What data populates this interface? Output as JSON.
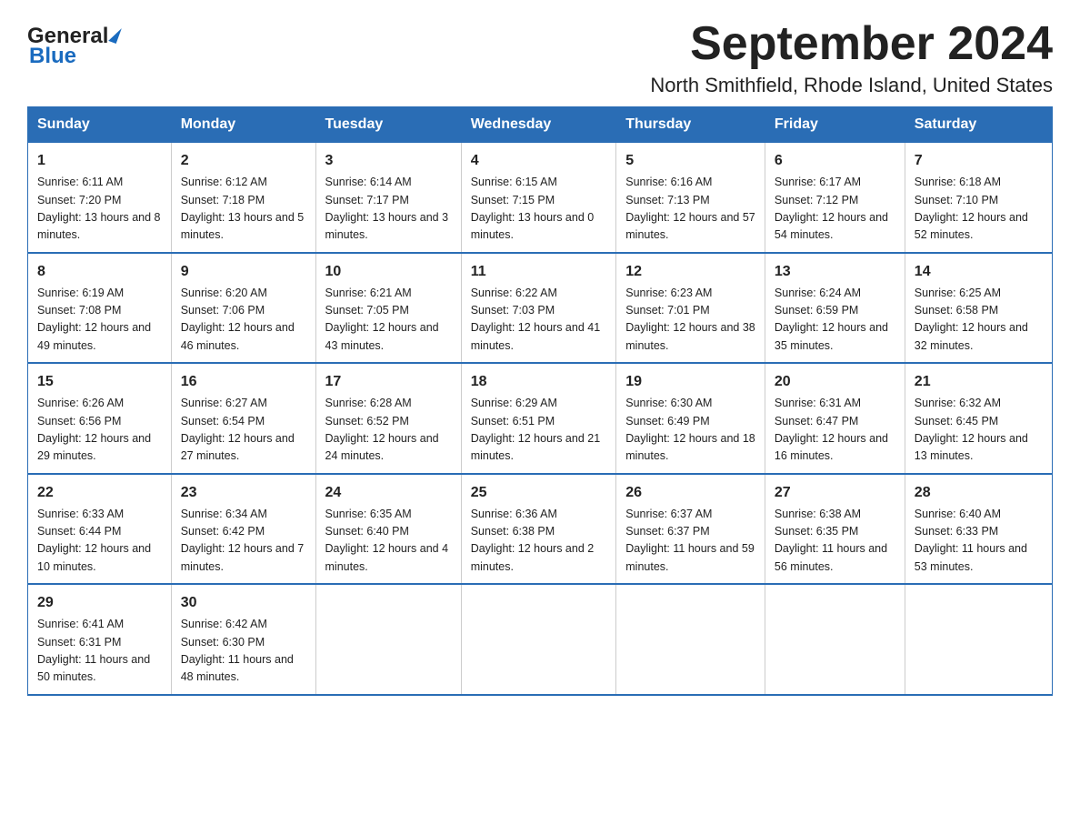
{
  "header": {
    "title": "September 2024",
    "subtitle": "North Smithfield, Rhode Island, United States",
    "logo_general": "General",
    "logo_blue": "Blue"
  },
  "calendar": {
    "days_of_week": [
      "Sunday",
      "Monday",
      "Tuesday",
      "Wednesday",
      "Thursday",
      "Friday",
      "Saturday"
    ],
    "weeks": [
      [
        {
          "date": "1",
          "sunrise": "6:11 AM",
          "sunset": "7:20 PM",
          "daylight": "13 hours and 8 minutes."
        },
        {
          "date": "2",
          "sunrise": "6:12 AM",
          "sunset": "7:18 PM",
          "daylight": "13 hours and 5 minutes."
        },
        {
          "date": "3",
          "sunrise": "6:14 AM",
          "sunset": "7:17 PM",
          "daylight": "13 hours and 3 minutes."
        },
        {
          "date": "4",
          "sunrise": "6:15 AM",
          "sunset": "7:15 PM",
          "daylight": "13 hours and 0 minutes."
        },
        {
          "date": "5",
          "sunrise": "6:16 AM",
          "sunset": "7:13 PM",
          "daylight": "12 hours and 57 minutes."
        },
        {
          "date": "6",
          "sunrise": "6:17 AM",
          "sunset": "7:12 PM",
          "daylight": "12 hours and 54 minutes."
        },
        {
          "date": "7",
          "sunrise": "6:18 AM",
          "sunset": "7:10 PM",
          "daylight": "12 hours and 52 minutes."
        }
      ],
      [
        {
          "date": "8",
          "sunrise": "6:19 AM",
          "sunset": "7:08 PM",
          "daylight": "12 hours and 49 minutes."
        },
        {
          "date": "9",
          "sunrise": "6:20 AM",
          "sunset": "7:06 PM",
          "daylight": "12 hours and 46 minutes."
        },
        {
          "date": "10",
          "sunrise": "6:21 AM",
          "sunset": "7:05 PM",
          "daylight": "12 hours and 43 minutes."
        },
        {
          "date": "11",
          "sunrise": "6:22 AM",
          "sunset": "7:03 PM",
          "daylight": "12 hours and 41 minutes."
        },
        {
          "date": "12",
          "sunrise": "6:23 AM",
          "sunset": "7:01 PM",
          "daylight": "12 hours and 38 minutes."
        },
        {
          "date": "13",
          "sunrise": "6:24 AM",
          "sunset": "6:59 PM",
          "daylight": "12 hours and 35 minutes."
        },
        {
          "date": "14",
          "sunrise": "6:25 AM",
          "sunset": "6:58 PM",
          "daylight": "12 hours and 32 minutes."
        }
      ],
      [
        {
          "date": "15",
          "sunrise": "6:26 AM",
          "sunset": "6:56 PM",
          "daylight": "12 hours and 29 minutes."
        },
        {
          "date": "16",
          "sunrise": "6:27 AM",
          "sunset": "6:54 PM",
          "daylight": "12 hours and 27 minutes."
        },
        {
          "date": "17",
          "sunrise": "6:28 AM",
          "sunset": "6:52 PM",
          "daylight": "12 hours and 24 minutes."
        },
        {
          "date": "18",
          "sunrise": "6:29 AM",
          "sunset": "6:51 PM",
          "daylight": "12 hours and 21 minutes."
        },
        {
          "date": "19",
          "sunrise": "6:30 AM",
          "sunset": "6:49 PM",
          "daylight": "12 hours and 18 minutes."
        },
        {
          "date": "20",
          "sunrise": "6:31 AM",
          "sunset": "6:47 PM",
          "daylight": "12 hours and 16 minutes."
        },
        {
          "date": "21",
          "sunrise": "6:32 AM",
          "sunset": "6:45 PM",
          "daylight": "12 hours and 13 minutes."
        }
      ],
      [
        {
          "date": "22",
          "sunrise": "6:33 AM",
          "sunset": "6:44 PM",
          "daylight": "12 hours and 10 minutes."
        },
        {
          "date": "23",
          "sunrise": "6:34 AM",
          "sunset": "6:42 PM",
          "daylight": "12 hours and 7 minutes."
        },
        {
          "date": "24",
          "sunrise": "6:35 AM",
          "sunset": "6:40 PM",
          "daylight": "12 hours and 4 minutes."
        },
        {
          "date": "25",
          "sunrise": "6:36 AM",
          "sunset": "6:38 PM",
          "daylight": "12 hours and 2 minutes."
        },
        {
          "date": "26",
          "sunrise": "6:37 AM",
          "sunset": "6:37 PM",
          "daylight": "11 hours and 59 minutes."
        },
        {
          "date": "27",
          "sunrise": "6:38 AM",
          "sunset": "6:35 PM",
          "daylight": "11 hours and 56 minutes."
        },
        {
          "date": "28",
          "sunrise": "6:40 AM",
          "sunset": "6:33 PM",
          "daylight": "11 hours and 53 minutes."
        }
      ],
      [
        {
          "date": "29",
          "sunrise": "6:41 AM",
          "sunset": "6:31 PM",
          "daylight": "11 hours and 50 minutes."
        },
        {
          "date": "30",
          "sunrise": "6:42 AM",
          "sunset": "6:30 PM",
          "daylight": "11 hours and 48 minutes."
        },
        null,
        null,
        null,
        null,
        null
      ]
    ]
  }
}
